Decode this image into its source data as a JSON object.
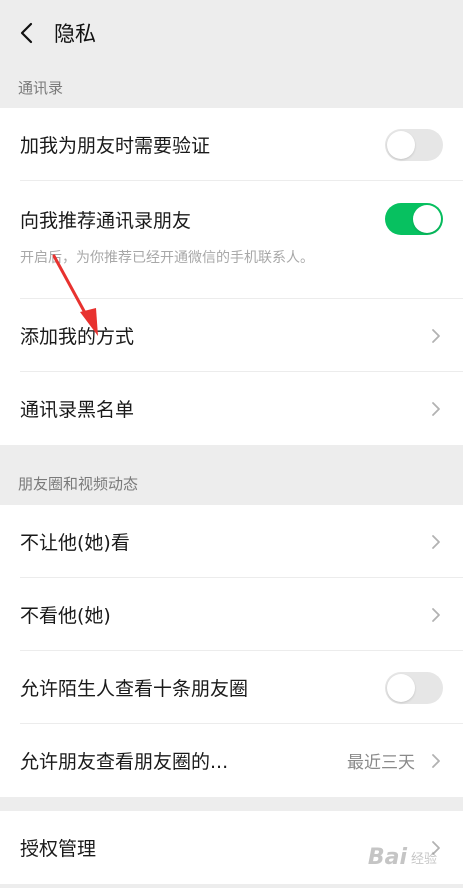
{
  "header": {
    "title": "隐私"
  },
  "sections": {
    "contacts": {
      "title": "通讯录",
      "require_verification": "加我为朋友时需要验证",
      "recommend_contacts": "向我推荐通讯录朋友",
      "recommend_desc": "开启后，为你推荐已经开通微信的手机联系人。",
      "add_methods": "添加我的方式",
      "blacklist": "通讯录黑名单"
    },
    "moments": {
      "title": "朋友圈和视频动态",
      "hide_from": "不让他(她)看",
      "dont_see": "不看他(她)",
      "allow_strangers": "允许陌生人查看十条朋友圈",
      "visible_range": "允许朋友查看朋友圈的...",
      "visible_range_value": "最近三天"
    },
    "auth": {
      "manage": "授权管理"
    }
  },
  "toggles": {
    "require_verification": false,
    "recommend_contacts": true,
    "allow_strangers": false
  },
  "watermark": {
    "text": "Bai",
    "sub": "经验"
  },
  "colors": {
    "accent": "#07c160",
    "annotation": "#e8322f"
  }
}
